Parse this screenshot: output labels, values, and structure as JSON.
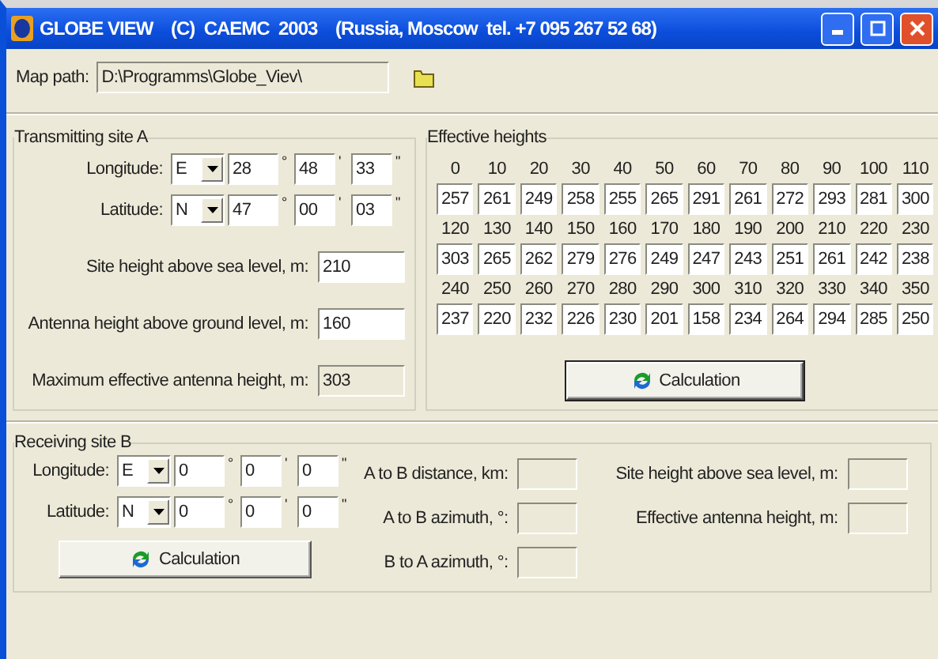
{
  "window": {
    "title": "GLOBE VIEW    (C)  CAEMC  2003    (Russia, Moscow  tel. +7 095 267 52 68)"
  },
  "map_path": {
    "label": "Map path:",
    "value": "D:\\Programms\\Globe_Viev\\",
    "disabled": true
  },
  "transmitting": {
    "title": "Transmitting site A",
    "units": [
      "°",
      "'",
      "\""
    ],
    "coords": [
      {
        "label": "Longitude:",
        "hemisphere": "E",
        "deg": "28",
        "min": "48",
        "sec": "33"
      },
      {
        "label": "Latitude:",
        "hemisphere": "N",
        "deg": "47",
        "min": "00",
        "sec": "03"
      }
    ],
    "fields": [
      {
        "label": "Site height above sea level, m:",
        "value": "210",
        "disabled": false
      },
      {
        "label": "Antenna height above ground level, m:",
        "value": "160",
        "disabled": false
      },
      {
        "label": "Maximum effective antenna height, m:",
        "value": "303",
        "disabled": true
      }
    ]
  },
  "effective_heights": {
    "title": "Effective heights",
    "rows": [
      {
        "angles": [
          "0",
          "10",
          "20",
          "30",
          "40",
          "50",
          "60",
          "70",
          "80",
          "90",
          "100",
          "110"
        ],
        "values": [
          "257",
          "261",
          "249",
          "258",
          "255",
          "265",
          "291",
          "261",
          "272",
          "293",
          "281",
          "300"
        ]
      },
      {
        "angles": [
          "120",
          "130",
          "140",
          "150",
          "160",
          "170",
          "180",
          "190",
          "200",
          "210",
          "220",
          "230"
        ],
        "values": [
          "303",
          "265",
          "262",
          "279",
          "276",
          "249",
          "247",
          "243",
          "251",
          "261",
          "242",
          "238"
        ]
      },
      {
        "angles": [
          "240",
          "250",
          "260",
          "270",
          "280",
          "290",
          "300",
          "310",
          "320",
          "330",
          "340",
          "350"
        ],
        "values": [
          "237",
          "220",
          "232",
          "226",
          "230",
          "201",
          "158",
          "234",
          "264",
          "294",
          "285",
          "250"
        ]
      }
    ],
    "button": "Calculation"
  },
  "receiving": {
    "title": "Receiving site B",
    "units": [
      "°",
      "'",
      "\""
    ],
    "coords": [
      {
        "label": "Longitude:",
        "hemisphere": "E",
        "deg": "0",
        "min": "0",
        "sec": "0"
      },
      {
        "label": "Latitude:",
        "hemisphere": "N",
        "deg": "0",
        "min": "0",
        "sec": "0"
      }
    ],
    "button": "Calculation",
    "results": [
      {
        "label": "A to B distance, km:",
        "disabled": true
      },
      {
        "label": "A to B azimuth, °:",
        "disabled": true
      },
      {
        "label": "B to A azimuth, °:",
        "disabled": true
      }
    ],
    "site_fields": [
      {
        "label": "Site height above sea level, m:",
        "disabled": true
      },
      {
        "label": "Effective antenna height, m:",
        "disabled": true
      }
    ]
  }
}
